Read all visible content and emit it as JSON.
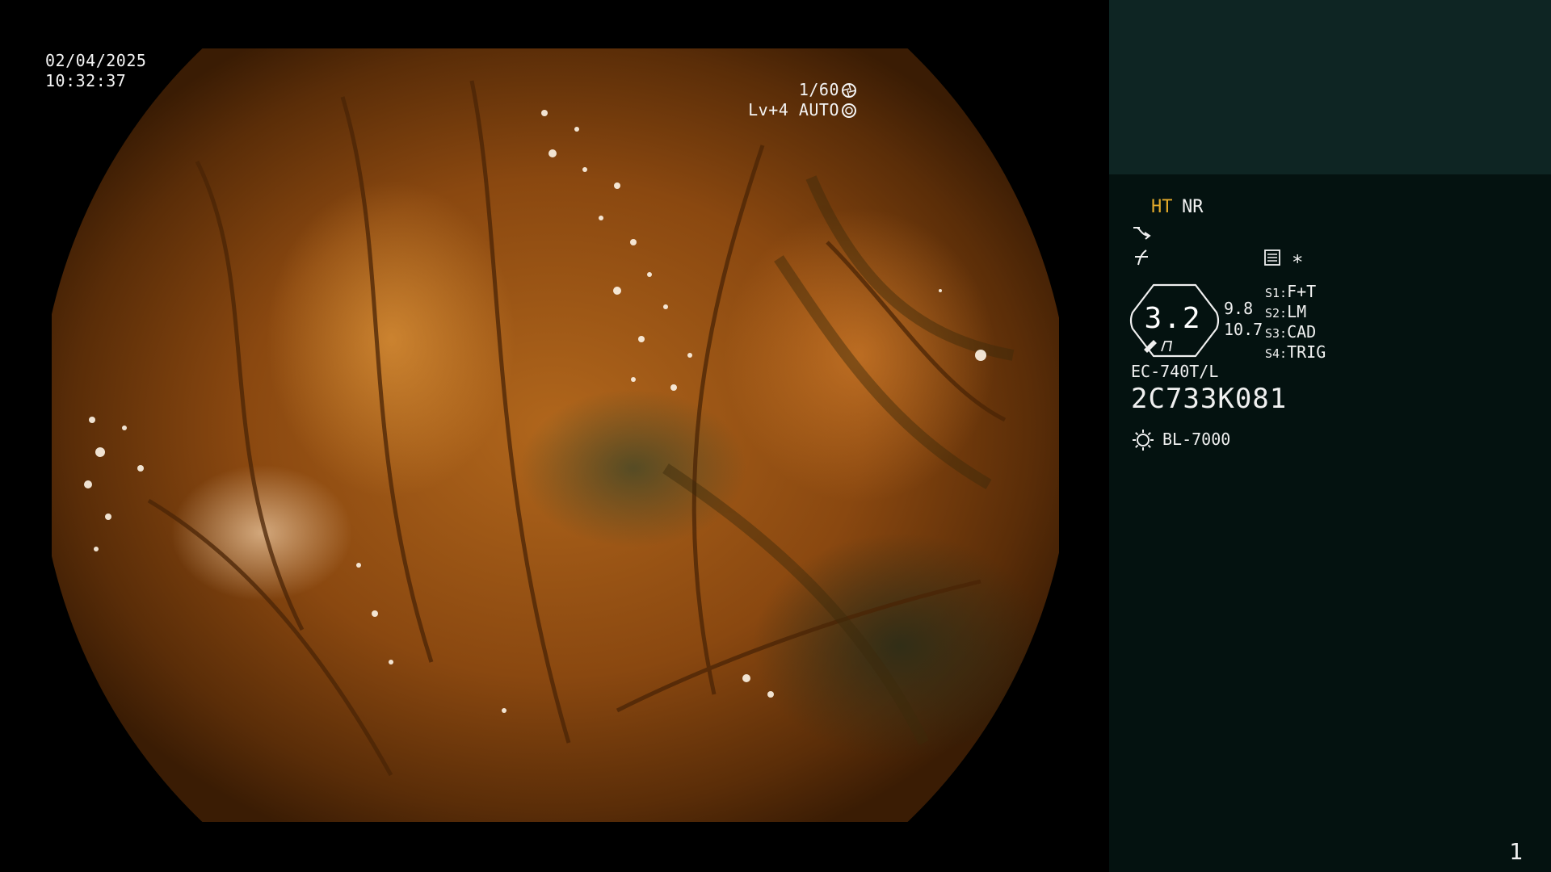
{
  "overlay": {
    "date": "02/04/2025",
    "time": "10:32:37",
    "shutter": "1/60",
    "shutter_icon": "shutter-icon",
    "level": "Lv+4 AUTO",
    "auto_icon": "iris-auto-icon"
  },
  "panel": {
    "mode_ht": "HT",
    "mode_nr": "NR",
    "icons": [
      "curve-icon",
      "flash-off-icon",
      "menu-icon",
      "star-icon"
    ],
    "star": "∗",
    "scale_value": "3.2",
    "scale_a": "9.8",
    "scale_b": "10.7",
    "switches": [
      {
        "key": "S1:",
        "value": "F+T"
      },
      {
        "key": "S2:",
        "value": "LM"
      },
      {
        "key": "S3:",
        "value": "CAD"
      },
      {
        "key": "S4:",
        "value": "TRIG"
      }
    ],
    "scope_model": "EC-740T/L",
    "scope_serial": "2C733K081",
    "light_source": "BL-7000",
    "page_number": "1"
  },
  "colors": {
    "background": "#000000",
    "panel_top": "#0e2523",
    "panel": "#041210",
    "accent_ht": "#e4aa2a",
    "text": "#f0f0f0"
  }
}
